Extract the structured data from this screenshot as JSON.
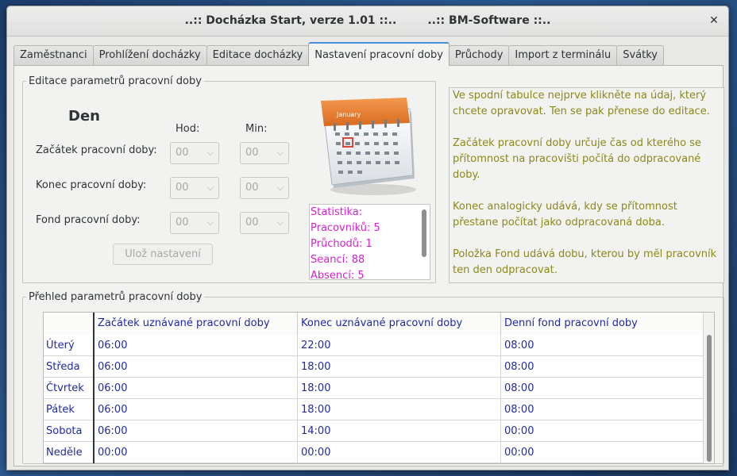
{
  "window": {
    "title": "..:: Docházka Start, verze 1.01 ::..        ..:: BM-Software ::..",
    "close_glyph": "✕"
  },
  "tabs": [
    {
      "label": "Zaměstnanci",
      "active": false
    },
    {
      "label": "Prohlížení docházky",
      "active": false
    },
    {
      "label": "Editace docházky",
      "active": false
    },
    {
      "label": "Nastavení pracovní doby",
      "active": true
    },
    {
      "label": "Průchody",
      "active": false
    },
    {
      "label": "Import z terminálu",
      "active": false
    },
    {
      "label": "Svátky",
      "active": false
    }
  ],
  "edit_group": {
    "legend": "Editace parametrů pracovní doby",
    "day": "Den",
    "col_hour": "Hod:",
    "col_min": "Min:",
    "rows": [
      {
        "label": "Začátek pracovní doby:",
        "hour": "00",
        "min": "00"
      },
      {
        "label": "Konec pracovní doby:",
        "hour": "00",
        "min": "00"
      },
      {
        "label": "Fond pracovní doby:",
        "hour": "00",
        "min": "00"
      }
    ],
    "save_label": "Ulož nastavení",
    "calendar_month": "January"
  },
  "stats": {
    "lines": [
      "Statistika:",
      "Pracovníků: 5",
      "Průchodů: 1",
      "Seancí: 88",
      "Absencí: 5"
    ],
    "color": "#d61ed0"
  },
  "help": {
    "color": "#8a8a17",
    "paragraphs": [
      "Ve spodní tabulce nejprve klikněte na údaj, který chcete opravovat. Ten se pak přenese do editace.",
      "Začátek pracovní doby určuje čas od kterého se přítomnost na pracovišti počítá do odpracované doby.",
      "Konec analogicky udává, kdy se přítomnost přestane počítat jako odpracovaná doba.",
      "Položka Fond udává dobu, kterou by měl pracovník ten den odpracovat."
    ]
  },
  "overview_group": {
    "legend": "Přehled parametrů pracovní doby",
    "columns": [
      "",
      "Začátek uznávané pracovní doby",
      "Konec uznávané pracovní doby",
      "Denní fond pracovní doby"
    ],
    "rows": [
      [
        "Úterý",
        "06:00",
        "22:00",
        "08:00"
      ],
      [
        "Středa",
        "06:00",
        "18:00",
        "08:00"
      ],
      [
        "Čtvrtek",
        "06:00",
        "18:00",
        "08:00"
      ],
      [
        "Pátek",
        "06:00",
        "18:00",
        "08:00"
      ],
      [
        "Sobota",
        "06:00",
        "14:00",
        "00:00"
      ],
      [
        "Neděle",
        "00:00",
        "00:00",
        "00:00"
      ]
    ],
    "text_color": "#1e2aa8"
  }
}
